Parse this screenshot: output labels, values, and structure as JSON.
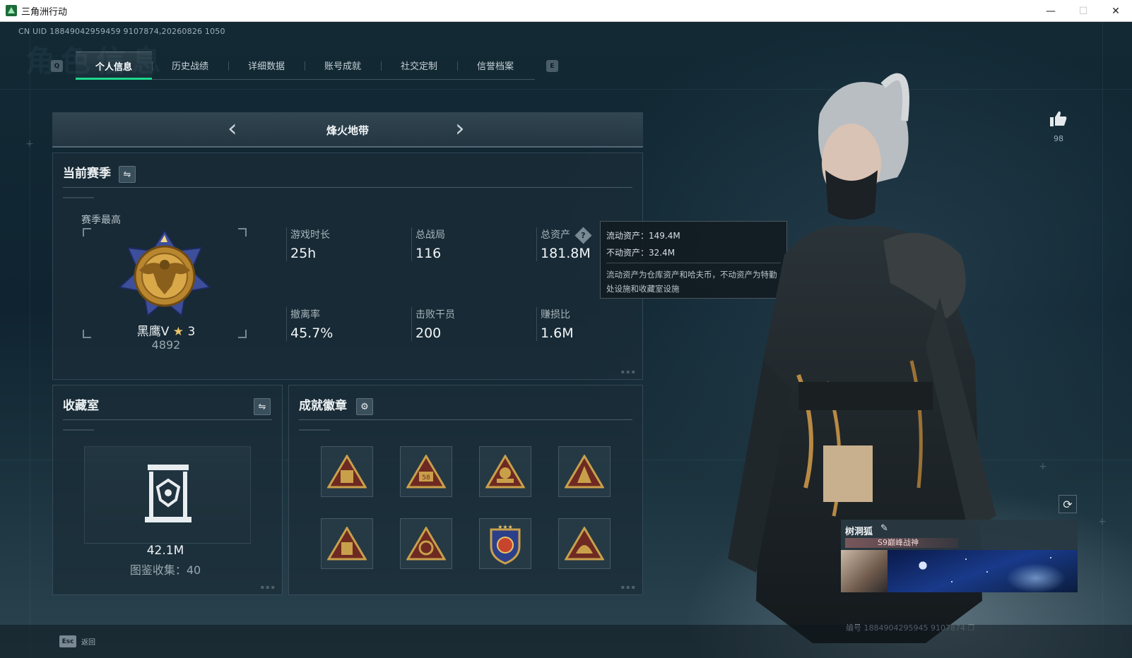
{
  "window": {
    "title": "三角洲行动",
    "minimize": "—",
    "maximize": "☐",
    "close": "✕"
  },
  "uid_line": "CN UID 18849042959459 9107874,20260826 1050",
  "ghost_title": "角色信息",
  "tabs": {
    "key_prev": "Q",
    "key_next": "E",
    "items": [
      {
        "label": "个人信息",
        "active": true
      },
      {
        "label": "历史战绩"
      },
      {
        "label": "详细数据"
      },
      {
        "label": "账号成就"
      },
      {
        "label": "社交定制"
      },
      {
        "label": "信誉档案"
      }
    ]
  },
  "mode": {
    "title": "烽火地带",
    "prev": "‹",
    "next": "›"
  },
  "current_season": {
    "title": "当前赛季",
    "best_label": "赛季最高",
    "rank_name": "黑鹰V",
    "rank_star": "★",
    "rank_stars": "3",
    "rank_score": "4892",
    "stats": [
      {
        "label": "游戏时长",
        "value": "25h"
      },
      {
        "label": "总战局",
        "value": "116"
      },
      {
        "label": "总资产",
        "value": "181.8M",
        "help": "?"
      },
      {
        "label": "撤离率",
        "value": "45.7%"
      },
      {
        "label": "击败干员",
        "value": "200"
      },
      {
        "label": "赚损比",
        "value": "1.6M"
      }
    ]
  },
  "asset_tooltip": {
    "liquid": "流动资产：149.4M",
    "fixed": "不动资产：32.4M",
    "note": "流动资产为仓库资产和哈夫币，不动资产为特勤处设施和收藏室设施"
  },
  "collection": {
    "title": "收藏室",
    "value": "42.1M",
    "count": "图鉴收集：40"
  },
  "badges": {
    "title": "成就徽章",
    "badge_8_label": "58"
  },
  "like": {
    "count": "98"
  },
  "player": {
    "name": "树洞狐",
    "title_tag": "S9巅峰战神",
    "id": "编号 1884904295945 9107874"
  },
  "bottom": {
    "esc": "Esc",
    "back": "返回"
  },
  "colors": {
    "accent": "#1ed88d",
    "gold": "#c9a04a",
    "panel": "#1a2c38"
  }
}
